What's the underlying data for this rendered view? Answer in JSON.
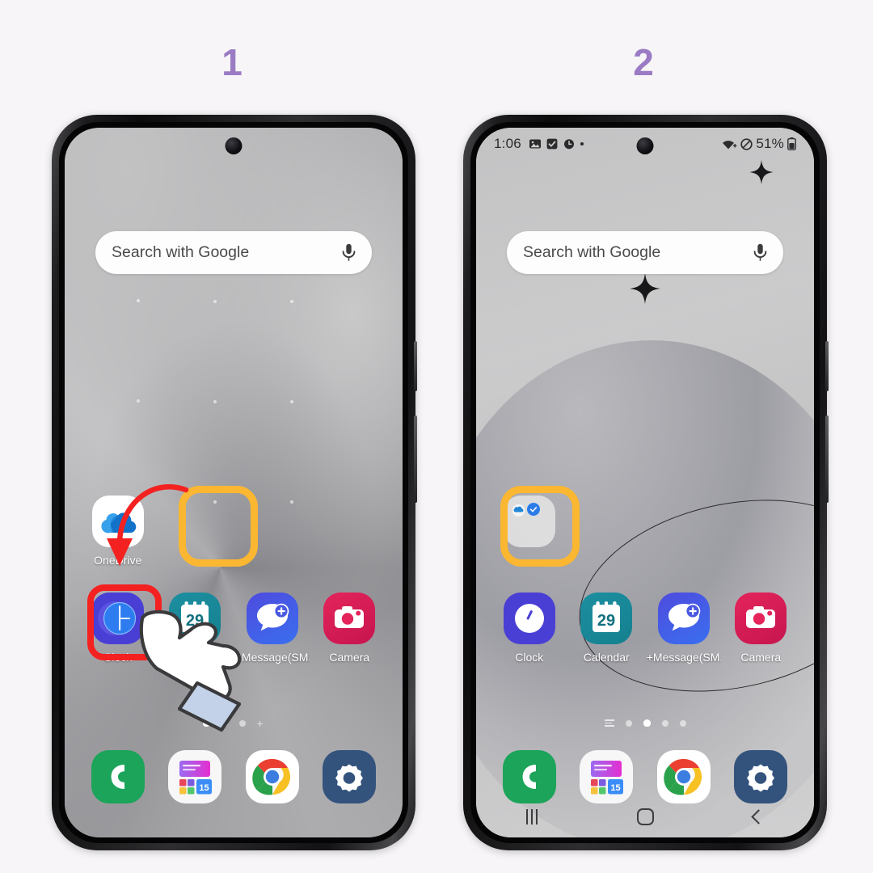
{
  "steps": [
    {
      "label": "1"
    },
    {
      "label": "2"
    }
  ],
  "colors": {
    "step_number": "#9b7bc4",
    "highlight_box": "#fbb731",
    "tap_box": "#f42121",
    "arrow": "#f42121",
    "page_background": "#f7f5f7"
  },
  "phone1": {
    "search": {
      "text": "Search with Google",
      "mic_icon": "microphone-icon"
    },
    "apps_row": [
      {
        "label": "OneDrive",
        "icon": "onedrive-icon"
      },
      {
        "label": "",
        "icon": "empty-slot"
      }
    ],
    "apps_row2": [
      {
        "label": "Clock",
        "icon": "clock-icon"
      },
      {
        "label": "Calendar",
        "icon": "calendar-icon",
        "badge": "29"
      },
      {
        "label": "+Message(SM...",
        "icon": "plus-message-icon"
      },
      {
        "label": "Camera",
        "icon": "camera-icon"
      }
    ],
    "dock": [
      {
        "label": "Phone",
        "icon": "phone-icon"
      },
      {
        "label": "Galaxy Store",
        "icon": "galaxy-store-icon",
        "badge": "15"
      },
      {
        "label": "Chrome",
        "icon": "chrome-icon"
      },
      {
        "label": "Settings",
        "icon": "settings-gear-icon"
      }
    ],
    "page_dots": {
      "count": 4,
      "active_index": 0,
      "has_plus": true
    }
  },
  "phone2": {
    "statusbar": {
      "time": "1:06",
      "icons_left": [
        "gallery-icon",
        "checkbox-icon",
        "alarm-icon",
        "dot-icon"
      ],
      "wifi_icon": "wifi-icon",
      "mute_icon": "do-not-disturb-icon",
      "battery_percent": "51%",
      "battery_icon": "battery-icon"
    },
    "search": {
      "text": "Search with Google",
      "mic_icon": "microphone-icon"
    },
    "folder": {
      "label": "",
      "icon": "folder-icon",
      "contents": [
        "onedrive-icon",
        "blue-app-icon"
      ]
    },
    "apps_row2": [
      {
        "label": "Clock",
        "icon": "clock-icon"
      },
      {
        "label": "Calendar",
        "icon": "calendar-icon",
        "badge": "29"
      },
      {
        "label": "+Message(SM...",
        "icon": "plus-message-icon"
      },
      {
        "label": "Camera",
        "icon": "camera-icon"
      }
    ],
    "dock": [
      {
        "label": "Phone",
        "icon": "phone-icon"
      },
      {
        "label": "Galaxy Store",
        "icon": "galaxy-store-icon",
        "badge": "15"
      },
      {
        "label": "Chrome",
        "icon": "chrome-icon"
      },
      {
        "label": "Settings",
        "icon": "settings-gear-icon"
      }
    ],
    "page_dots": {
      "count": 5,
      "active_index": 2,
      "has_list": true
    },
    "navbar": {
      "recents": "recents-icon",
      "home": "home-icon",
      "back": "back-icon"
    }
  }
}
